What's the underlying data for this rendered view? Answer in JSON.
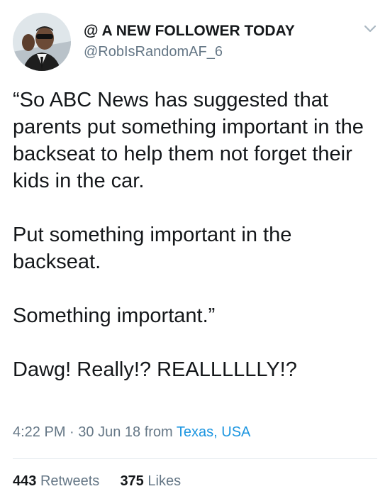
{
  "tweet": {
    "display_name": "@ A NEW FOLLOWER TODAY",
    "handle": "@RobIsRandomAF_6",
    "text": "“So ABC News has suggested that parents put something important in the backseat to help them not forget their kids in the car.\n\nPut something important in the backseat.\n\nSomething important.”\n\nDawg! Really!? REALLLLLLY!?",
    "time": "4:22 PM",
    "separator": "·",
    "date": "30 Jun 18",
    "from_label": "from",
    "location": "Texas, USA",
    "retweets_count": "443",
    "retweets_label": "Retweets",
    "likes_count": "375",
    "likes_label": "Likes"
  },
  "icons": {
    "avatar": "profile-avatar",
    "menu": "chevron-down-icon"
  },
  "colors": {
    "text": "#14171a",
    "secondary": "#657786",
    "link": "#1b95e0",
    "divider": "#e1e8ed"
  }
}
